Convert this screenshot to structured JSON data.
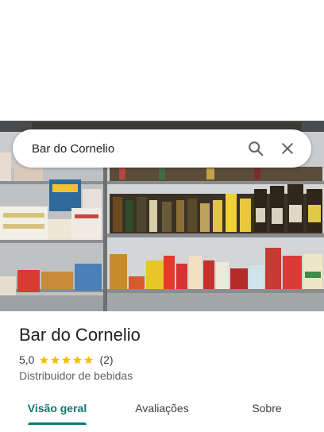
{
  "search": {
    "query": "Bar do Cornelio"
  },
  "place": {
    "name": "Bar do Cornelio",
    "rating": "5,0",
    "stars": 5,
    "review_count": "(2)",
    "category": "Distribuidor de bebidas"
  },
  "tabs": [
    {
      "label": "Visão geral",
      "active": true
    },
    {
      "label": "Avaliações",
      "active": false
    },
    {
      "label": "Sobre",
      "active": false
    }
  ],
  "colors": {
    "accent": "#0a7a6f",
    "star": "#fbbc04"
  },
  "icons": {
    "search": "search-icon",
    "close": "close-icon",
    "star": "star-icon"
  }
}
